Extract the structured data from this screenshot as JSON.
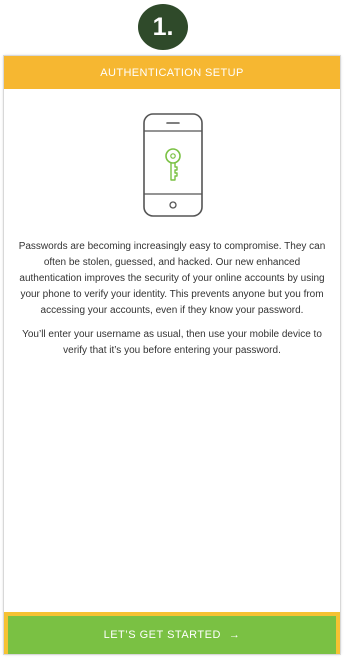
{
  "step_badge": "1.",
  "header": {
    "title": "AUTHENTICATION SETUP"
  },
  "illustration": {
    "icon": "phone-with-key-icon",
    "phone_color": "#555555",
    "key_color": "#7ac143"
  },
  "content": {
    "paragraph1": "Passwords are becoming increasingly easy to compromise. They can often be stolen, guessed, and hacked. Our new enhanced authentication improves the security of your online accounts by using your phone to verify your identity. This prevents anyone but you from accessing your accounts, even if they know your password.",
    "paragraph2": "You’ll enter your username as usual, then use your mobile device to verify that it’s you before entering your password."
  },
  "cta": {
    "label": "LET’S GET STARTED",
    "icon": "arrow-right-icon",
    "glyph": "→"
  },
  "colors": {
    "header": "#f6b731",
    "button": "#7ac143",
    "badge": "#2f4a2a"
  }
}
